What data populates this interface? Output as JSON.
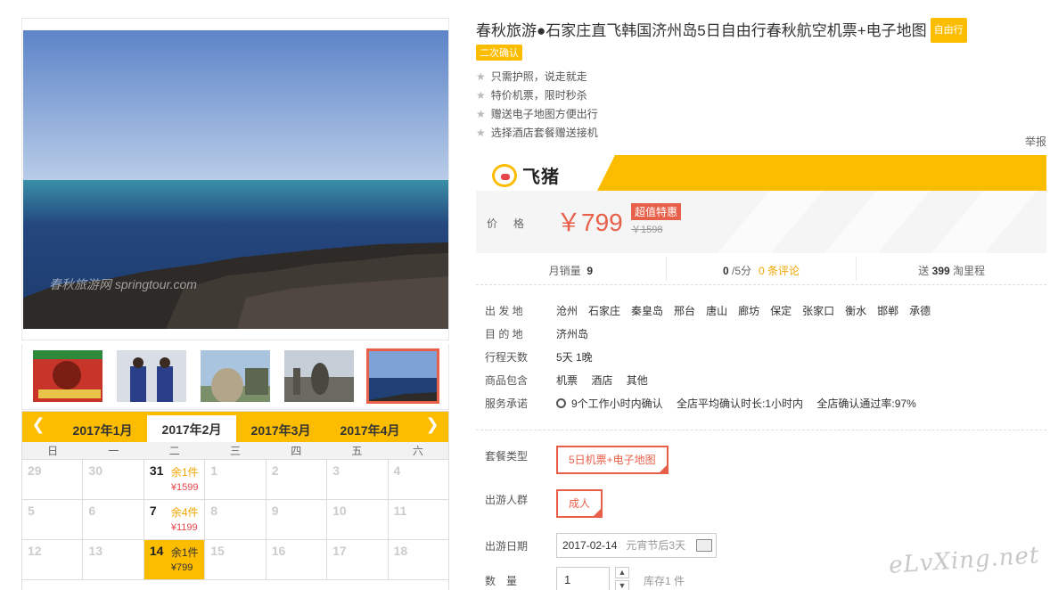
{
  "product": {
    "title": "春秋旅游●石家庄直飞韩国济州岛5日自由行春秋航空机票+电子地图",
    "tag_free": "自由行",
    "tag_confirm": "二次确认",
    "features": [
      "只需护照，说走就走",
      "特价机票，限时秒杀",
      "赠送电子地图方便出行",
      "选择酒店套餐赠送接机"
    ],
    "report": "举报"
  },
  "brand": {
    "name": "飞猪"
  },
  "price": {
    "label": "价格",
    "value": "￥799",
    "badge": "超值特惠",
    "old": "￥1598"
  },
  "stats": {
    "sales_label": "月销量",
    "sales": "9",
    "score": "0",
    "score_suffix": "/5分",
    "reviews": "0 条评论",
    "points_prefix": "送",
    "points": "399",
    "points_suffix": "淘里程"
  },
  "info": {
    "departure_label": "出 发 地",
    "departures": [
      "沧州",
      "石家庄",
      "秦皇岛",
      "邢台",
      "唐山",
      "廊坊",
      "保定",
      "张家口",
      "衡水",
      "邯郸",
      "承德"
    ],
    "dest_label": "目 的 地",
    "dest": "济州岛",
    "days_label": "行程天数",
    "days": "5天 1晚",
    "includes_label": "商品包含",
    "includes": [
      "机票",
      "酒店",
      "其他"
    ],
    "service_label": "服务承诺",
    "services": [
      "9个工作小时内确认",
      "全店平均确认时长:1小时内",
      "全店确认通过率:97%"
    ]
  },
  "options": {
    "package_label": "套餐类型",
    "package": "5日机票+电子地图",
    "crowd_label": "出游人群",
    "crowd": "成人",
    "date_label": "出游日期",
    "date": "2017-02-14",
    "date_hint": "元宵节后3天",
    "qty_label": "数　量",
    "qty": "1",
    "stock": "库存1 件"
  },
  "calendar": {
    "months": [
      "2017年1月",
      "2017年2月",
      "2017年3月",
      "2017年4月"
    ],
    "active_month": 1,
    "weekdays": [
      "日",
      "一",
      "二",
      "三",
      "四",
      "五",
      "六"
    ],
    "rows": [
      [
        {
          "d": "29"
        },
        {
          "d": "30"
        },
        {
          "d": "31",
          "stock": "余1件",
          "price": "¥1599"
        },
        {
          "d": "1"
        },
        {
          "d": "2"
        },
        {
          "d": "3"
        },
        {
          "d": "4"
        }
      ],
      [
        {
          "d": "5"
        },
        {
          "d": "6"
        },
        {
          "d": "7",
          "stock": "余4件",
          "price": "¥1199"
        },
        {
          "d": "8"
        },
        {
          "d": "9"
        },
        {
          "d": "10"
        },
        {
          "d": "11"
        }
      ],
      [
        {
          "d": "12"
        },
        {
          "d": "13"
        },
        {
          "d": "14",
          "stock": "余1件",
          "price": "¥799",
          "selected": true
        },
        {
          "d": "15"
        },
        {
          "d": "16"
        },
        {
          "d": "17"
        },
        {
          "d": "18"
        }
      ]
    ]
  },
  "watermark": "eLvXing.net",
  "photo_watermark": "春秋旅游网 springtour.com",
  "colors": {
    "accent": "#fcbd00",
    "price": "#e8604a"
  }
}
